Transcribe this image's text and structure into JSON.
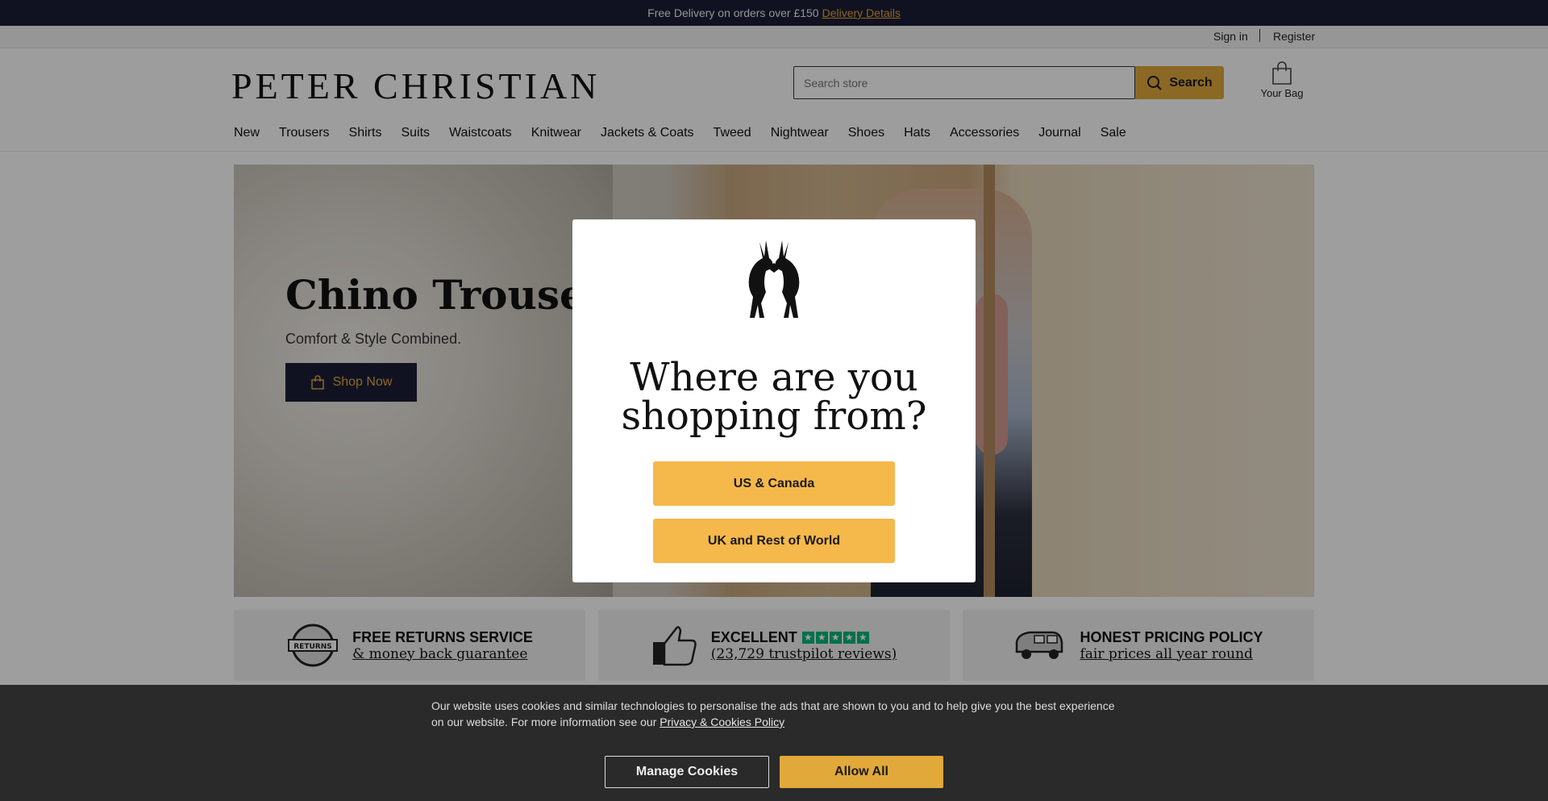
{
  "promo": {
    "text": "Free Delivery on orders over £150",
    "link": "Delivery Details"
  },
  "account": {
    "signin": "Sign in",
    "register": "Register"
  },
  "header": {
    "logo": "PETER CHRISTIAN",
    "search_placeholder": "Search store",
    "search_label": "Search",
    "bag_label": "Your Bag"
  },
  "nav": {
    "items": [
      "New",
      "Trousers",
      "Shirts",
      "Suits",
      "Waistcoats",
      "Knitwear",
      "Jackets & Coats",
      "Tweed",
      "Nightwear",
      "Shoes",
      "Hats",
      "Accessories",
      "Journal",
      "Sale"
    ]
  },
  "hero": {
    "title": "Chino Trousers",
    "subtitle": "Comfort & Style Combined.",
    "cta": "Shop Now"
  },
  "usps": [
    {
      "title": "FREE RETURNS SERVICE",
      "subtitle": "& money back guarantee",
      "icon": "returns-badge-icon"
    },
    {
      "title": "EXCELLENT",
      "subtitle": "(23,729 trustpilot reviews)",
      "icon": "thumbs-up-icon",
      "rating": 5
    },
    {
      "title": "HONEST PRICING POLICY",
      "subtitle": "fair prices all year round",
      "icon": "van-icon"
    }
  ],
  "modal": {
    "heading_line1": "Where are you",
    "heading_line2": "shopping from?",
    "option_us": "US & Canada",
    "option_uk": "UK and Rest of World"
  },
  "cookies": {
    "text": "Our website uses cookies and similar technologies to personalise the ads that are shown to you and to help give you the best experience on our website. For more information see our",
    "link": "Privacy & Cookies Policy",
    "manage": "Manage Cookies",
    "allow": "Allow All"
  },
  "colors": {
    "navy": "#1c1d36",
    "gold": "#e0a93a",
    "button_gold": "#f5b84b",
    "trustpilot_green": "#00b67a"
  }
}
